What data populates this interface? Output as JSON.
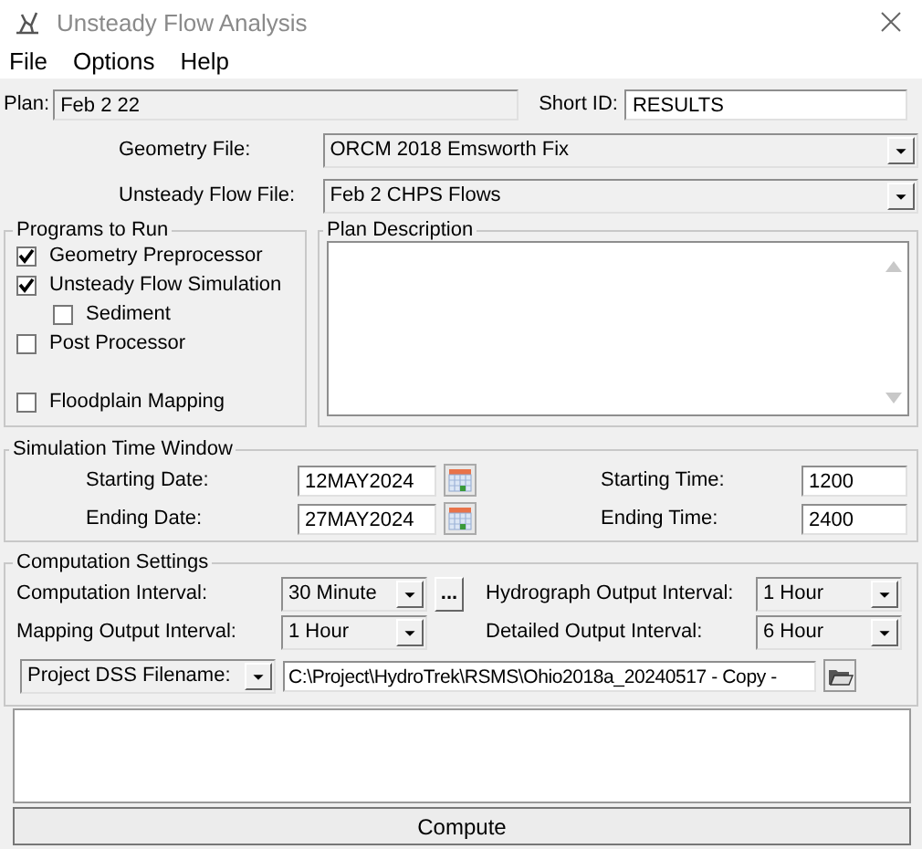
{
  "window": {
    "title": "Unsteady Flow Analysis"
  },
  "menu": [
    "File",
    "Options",
    "Help"
  ],
  "plan": {
    "label": "Plan:",
    "value": "Feb 2 22"
  },
  "short_id": {
    "label": "Short ID:",
    "value": "RESULTS"
  },
  "geometry_file": {
    "label": "Geometry File:",
    "value": "ORCM 2018 Emsworth Fix"
  },
  "unsteady_flow_file": {
    "label": "Unsteady Flow File:",
    "value": "Feb 2 CHPS Flows"
  },
  "programs_to_run": {
    "title": "Programs to Run",
    "items": [
      {
        "label": "Geometry Preprocessor",
        "checked": true
      },
      {
        "label": "Unsteady Flow Simulation",
        "checked": true,
        "children": [
          {
            "label": "Sediment",
            "checked": false
          }
        ]
      },
      {
        "label": "Post Processor",
        "checked": false
      },
      {
        "label": "Floodplain Mapping",
        "checked": false
      }
    ]
  },
  "plan_description": {
    "title": "Plan Description"
  },
  "simulation_time_window": {
    "title": "Simulation Time Window",
    "starting_date": {
      "label": "Starting Date:",
      "value": "12MAY2024"
    },
    "ending_date": {
      "label": "Ending Date:",
      "value": "27MAY2024"
    },
    "starting_time": {
      "label": "Starting Time:",
      "value": "1200"
    },
    "ending_time": {
      "label": "Ending Time:",
      "value": "2400"
    }
  },
  "computation_settings": {
    "title": "Computation Settings",
    "computation_interval": {
      "label": "Computation Interval:",
      "value": "30 Minute"
    },
    "more_button": "...",
    "hydrograph_output_interval": {
      "label": "Hydrograph Output Interval:",
      "value": "1 Hour"
    },
    "mapping_output_interval": {
      "label": "Mapping Output Interval:",
      "value": "1 Hour"
    },
    "detailed_output_interval": {
      "label": "Detailed Output Interval:",
      "value": "6 Hour"
    },
    "project_dss": {
      "label": "Project DSS Filename:",
      "value": "C:\\Project\\HydroTrek\\RSMS\\Ohio2018a_20240517 - Copy -"
    }
  },
  "compute_button": "Compute"
}
